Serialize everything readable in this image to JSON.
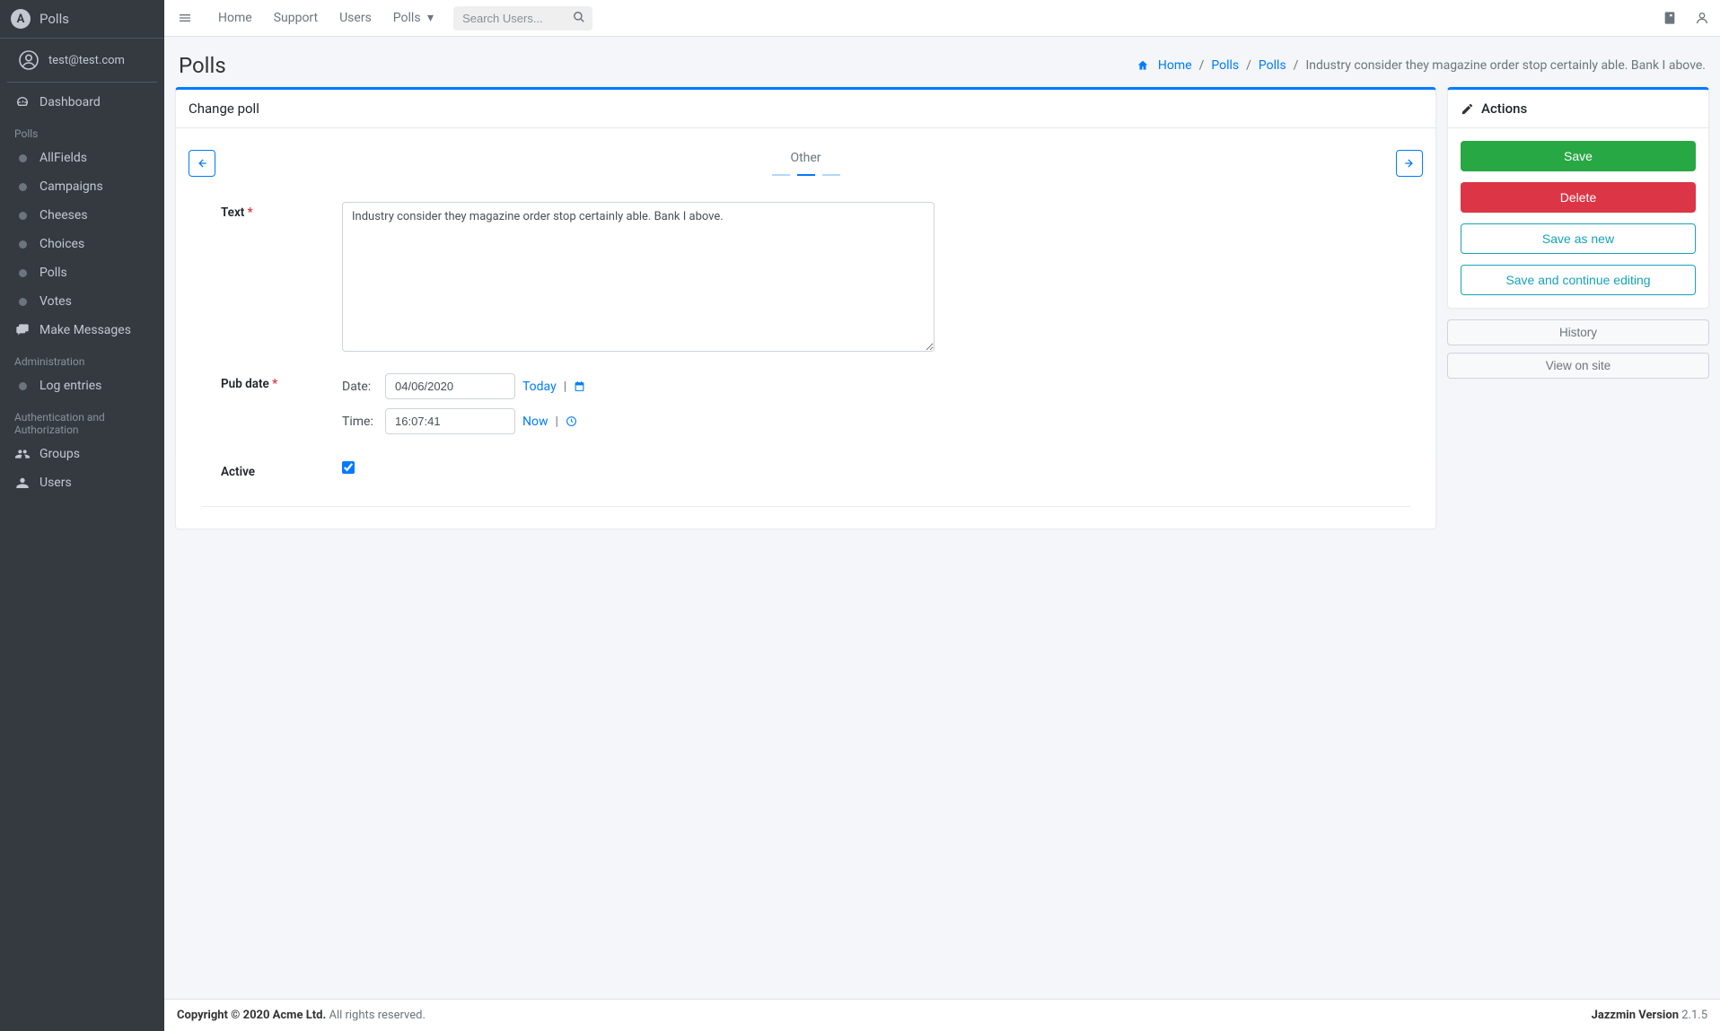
{
  "brand": {
    "name": "Polls"
  },
  "user": {
    "email": "test@test.com"
  },
  "sidebar": {
    "dashboard": "Dashboard",
    "sections": [
      {
        "header": "Polls",
        "items": [
          "AllFields",
          "Campaigns",
          "Cheeses",
          "Choices",
          "Polls",
          "Votes",
          "Make Messages"
        ]
      },
      {
        "header": "Administration",
        "items": [
          "Log entries"
        ]
      },
      {
        "header": "Authentication and Authorization",
        "items": [
          "Groups",
          "Users"
        ]
      }
    ]
  },
  "topbar": {
    "links": [
      "Home",
      "Support",
      "Users",
      "Polls"
    ],
    "search_placeholder": "Search Users..."
  },
  "page": {
    "title": "Polls"
  },
  "breadcrumb": {
    "home": "Home",
    "items": [
      "Polls",
      "Polls"
    ],
    "active": "Industry consider they magazine order stop certainly able. Bank I above."
  },
  "card": {
    "title": "Change poll",
    "tab_label": "Other"
  },
  "form": {
    "text_label": "Text",
    "text_value": "Industry consider they magazine order stop certainly able. Bank I above.",
    "pubdate_label": "Pub date",
    "date_label": "Date:",
    "date_value": "04/06/2020",
    "today": "Today",
    "time_label": "Time:",
    "time_value": "16:07:41",
    "now": "Now",
    "active_label": "Active"
  },
  "actions": {
    "title": "Actions",
    "save": "Save",
    "delete": "Delete",
    "save_as_new": "Save as new",
    "save_continue": "Save and continue editing",
    "history": "History",
    "view_on_site": "View on site"
  },
  "footer": {
    "copyright_strong": "Copyright © 2020 Acme Ltd.",
    "copyright_rest": " All rights reserved.",
    "version_label": "Jazzmin Version",
    "version_value": " 2.1.5"
  }
}
